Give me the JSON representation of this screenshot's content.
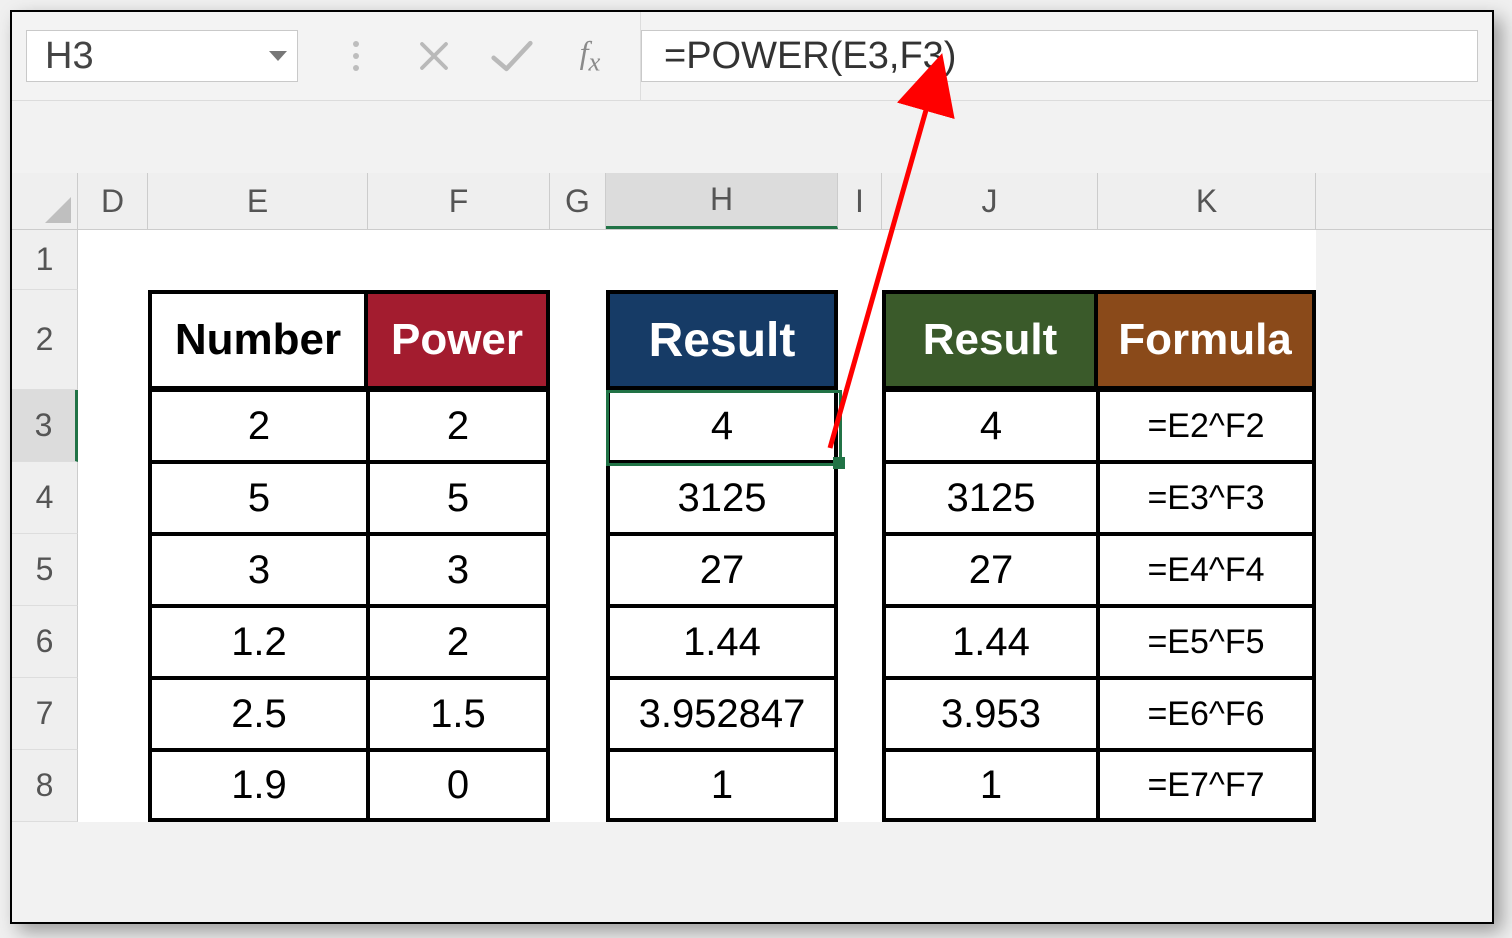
{
  "name_box": "H3",
  "formula_bar": "=POWER(E3,F3)",
  "columns": [
    "D",
    "E",
    "F",
    "G",
    "H",
    "I",
    "J",
    "K"
  ],
  "row_nums": [
    "1",
    "2",
    "3",
    "4",
    "5",
    "6",
    "7",
    "8"
  ],
  "headers": {
    "number": "Number",
    "power": "Power",
    "result": "Result",
    "result2": "Result",
    "formula": "Formula"
  },
  "data": [
    {
      "num": "2",
      "pow": "2",
      "h": "4",
      "j": "4",
      "k": "=E2^F2"
    },
    {
      "num": "5",
      "pow": "5",
      "h": "3125",
      "j": "3125",
      "k": "=E3^F3"
    },
    {
      "num": "3",
      "pow": "3",
      "h": "27",
      "j": "27",
      "k": "=E4^F4"
    },
    {
      "num": "1.2",
      "pow": "2",
      "h": "1.44",
      "j": "1.44",
      "k": "=E5^F5"
    },
    {
      "num": "2.5",
      "pow": "1.5",
      "h": "3.952847",
      "j": "3.953",
      "k": "=E6^F6"
    },
    {
      "num": "1.9",
      "pow": "0",
      "h": "1",
      "j": "1",
      "k": "=E7^F7"
    }
  ],
  "chart_data": {
    "type": "table",
    "title": "Excel POWER function example",
    "columns": [
      "Number",
      "Power",
      "Result (POWER)",
      "Result (^)",
      "Formula"
    ],
    "rows": [
      [
        2,
        2,
        4,
        4,
        "=E2^F2"
      ],
      [
        5,
        5,
        3125,
        3125,
        "=E3^F3"
      ],
      [
        3,
        3,
        27,
        27,
        "=E4^F4"
      ],
      [
        1.2,
        2,
        1.44,
        1.44,
        "=E5^F5"
      ],
      [
        2.5,
        1.5,
        3.952847,
        3.953,
        "=E6^F6"
      ],
      [
        1.9,
        0,
        1,
        1,
        "=E7^F7"
      ]
    ]
  }
}
